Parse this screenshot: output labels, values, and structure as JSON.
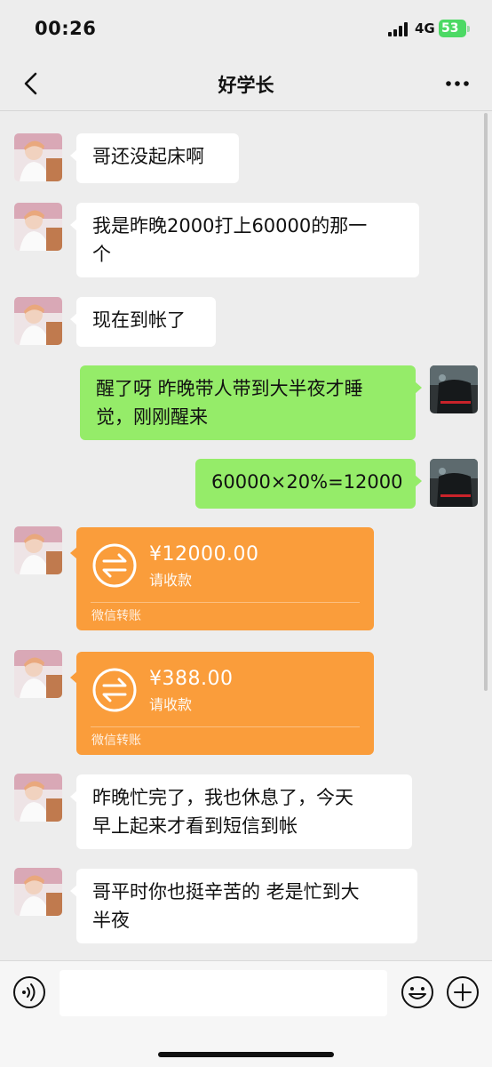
{
  "status_bar": {
    "time": "00:26",
    "network": "4G",
    "battery": "53",
    "icons": [
      "cellular-signal-icon",
      "battery-charging-icon"
    ]
  },
  "header": {
    "title": "好学长",
    "icons": [
      "chevron-left-icon",
      "more-icon"
    ]
  },
  "messages": [
    {
      "side": "left",
      "type": "text",
      "text": "哥还没起床啊"
    },
    {
      "side": "left",
      "type": "text",
      "line1": "我是昨晚2000打上60000的那一",
      "line2": "个"
    },
    {
      "side": "left",
      "type": "text",
      "text": "现在到帐了"
    },
    {
      "side": "right",
      "type": "text",
      "line1": "醒了呀 昨晚带人带到大半夜才睡",
      "line2": "觉，刚刚醒来"
    },
    {
      "side": "right",
      "type": "text",
      "text": "60000×20%=12000"
    },
    {
      "side": "left",
      "type": "transfer",
      "amount": "¥12000.00",
      "status": "请收款",
      "footer": "微信转账"
    },
    {
      "side": "left",
      "type": "transfer",
      "amount": "¥388.00",
      "status": "请收款",
      "footer": "微信转账"
    },
    {
      "side": "left",
      "type": "text",
      "line1": "昨晚忙完了，我也休息了，今天",
      "line2": "早上起来才看到短信到帐"
    },
    {
      "side": "left",
      "type": "text",
      "line1": "哥平时你也挺辛苦的 老是忙到大",
      "line2": "半夜"
    }
  ],
  "input_bar": {
    "placeholder": "",
    "icons": [
      "voice-icon",
      "emoji-icon",
      "plus-icon"
    ]
  },
  "colors": {
    "background": "#ededed",
    "bubble_sent": "#95ec69",
    "bubble_received": "#ffffff",
    "transfer": "#fa9d3b",
    "battery": "#4cd964"
  }
}
